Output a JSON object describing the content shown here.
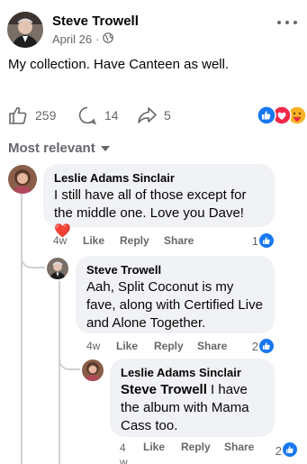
{
  "post": {
    "author": "Steve Trowell",
    "date": "April 26",
    "separator": "·",
    "privacy_icon": "globe-icon",
    "more_icon": "more-horizontal-icon",
    "text": "My collection. Have Canteen as well."
  },
  "stats": {
    "likes": "259",
    "comments": "14",
    "shares": "5",
    "reaction_icons": [
      "like-reaction-icon",
      "love-reaction-icon",
      "care-reaction-icon"
    ]
  },
  "sort": {
    "label": "Most relevant"
  },
  "comments": [
    {
      "author": "Leslie Adams Sinclair",
      "text": "I still have all of those except for the middle one. Love you Dave! ",
      "emoji": "❤️",
      "time": "4w",
      "like": "Like",
      "reply": "Reply",
      "share": "Share",
      "reaction_count": "1"
    },
    {
      "author": "Steve Trowell",
      "text": "Aah, Split Coconut is my fave, along with Certified Live and Alone Together.",
      "time": "4w",
      "like": "Like",
      "reply": "Reply",
      "share": "Share",
      "reaction_count": "2"
    },
    {
      "author": "Leslie Adams Sinclair",
      "mention": "Steve Trowell",
      "text": " I have the album with Mama Cass too.",
      "time_num": "4",
      "time_unit": "w",
      "like": "Like",
      "reply": "Reply",
      "share": "Share",
      "reaction_count": "2"
    }
  ],
  "colors": {
    "text": "#050505",
    "secondary": "#65676b",
    "bubble": "#f0f2f5",
    "like_blue": "#1877f2",
    "love_red": "#f02849"
  }
}
